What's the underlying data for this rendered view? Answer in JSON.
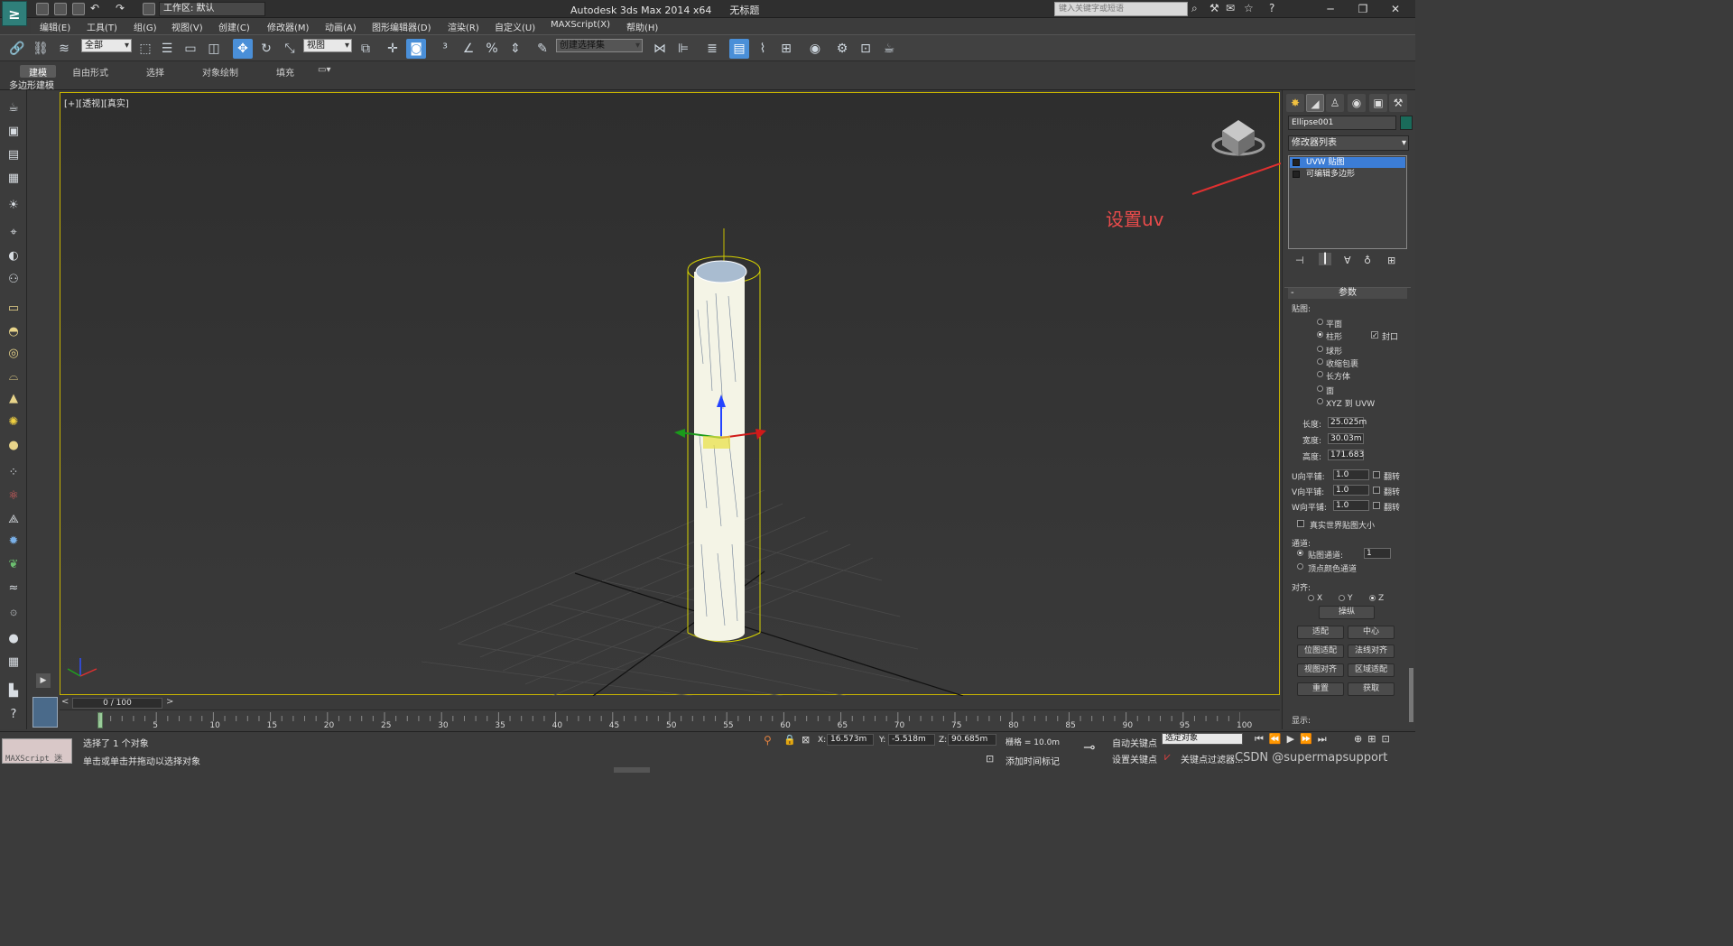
{
  "title": {
    "app": "Autodesk 3ds Max  2014 x64",
    "doc": "无标题",
    "workspace": "工作区: 默认",
    "search_placeholder": "键入关键字或短语"
  },
  "menu": [
    "编辑(E)",
    "工具(T)",
    "组(G)",
    "视图(V)",
    "创建(C)",
    "修改器(M)",
    "动画(A)",
    "图形编辑器(D)",
    "渲染(R)",
    "自定义(U)",
    "MAXScript(X)",
    "帮助(H)"
  ],
  "toolbar": {
    "selection_filter": "全部",
    "ref_coord": "视图",
    "named_selection": "创建选择集"
  },
  "ribbon": {
    "tabs": [
      "建模",
      "自由形式",
      "选择",
      "对象绘制",
      "填充"
    ],
    "sub": "多边形建模"
  },
  "viewport": {
    "label": "[+][透视][真实]",
    "annotation": "设置uv"
  },
  "panel": {
    "object_name": "Ellipse001",
    "modifier_list": "修改器列表",
    "stack": [
      "UVW 贴图",
      "可编辑多边形"
    ],
    "params_title": "参数",
    "mapping_label": "贴图:",
    "mapping": [
      "平面",
      "柱形",
      "球形",
      "收缩包裹",
      "长方体",
      "面",
      "XYZ 到 UVW"
    ],
    "cap": "封口",
    "length_label": "长度:",
    "length": "25.025m",
    "width_label": "宽度:",
    "width": "30.03m",
    "height_label": "高度:",
    "height": "171.683",
    "u_tile_label": "U向平铺:",
    "u_tile": "1.0",
    "v_tile_label": "V向平铺:",
    "v_tile": "1.0",
    "w_tile_label": "W向平铺:",
    "w_tile": "1.0",
    "flip": "翻转",
    "real_world": "真实世界贴图大小",
    "channel_label": "通道:",
    "map_channel": "贴图通道:",
    "map_channel_value": "1",
    "vertex_color": "顶点颜色通道",
    "align_label": "对齐:",
    "axis_x": "X",
    "axis_y": "Y",
    "axis_z": "Z",
    "manipulate": "操纵",
    "fit": "适配",
    "center": "中心",
    "bitmap_fit": "位图适配",
    "normal_align": "法线对齐",
    "view_align": "视图对齐",
    "region_fit": "区域适配",
    "reset": "重置",
    "acquire": "获取",
    "display_label": "显示:"
  },
  "timeline": {
    "frame": "0 / 100",
    "ticks": [
      "5",
      "10",
      "15",
      "20",
      "25",
      "30",
      "35",
      "40",
      "45",
      "50",
      "55",
      "60",
      "65",
      "70",
      "75",
      "80",
      "85",
      "90",
      "95",
      "100"
    ]
  },
  "status": {
    "maxscript": "MAXScript 迷",
    "selected": "选择了 1 个对象",
    "prompt": "单击或单击并拖动以选择对象",
    "x_label": "X:",
    "x": "16.573m",
    "y_label": "Y:",
    "y": "-5.518m",
    "z_label": "Z:",
    "z": "90.685m",
    "grid": "栅格 = 10.0m",
    "auto_key": "自动关键点",
    "set_key": "设置关键点",
    "key_filter_value": "选定对象",
    "key_filters": "关键点过滤器...",
    "add_time_tag": "添加时间标记",
    "watermark": "CSDN @supermapsupport"
  }
}
